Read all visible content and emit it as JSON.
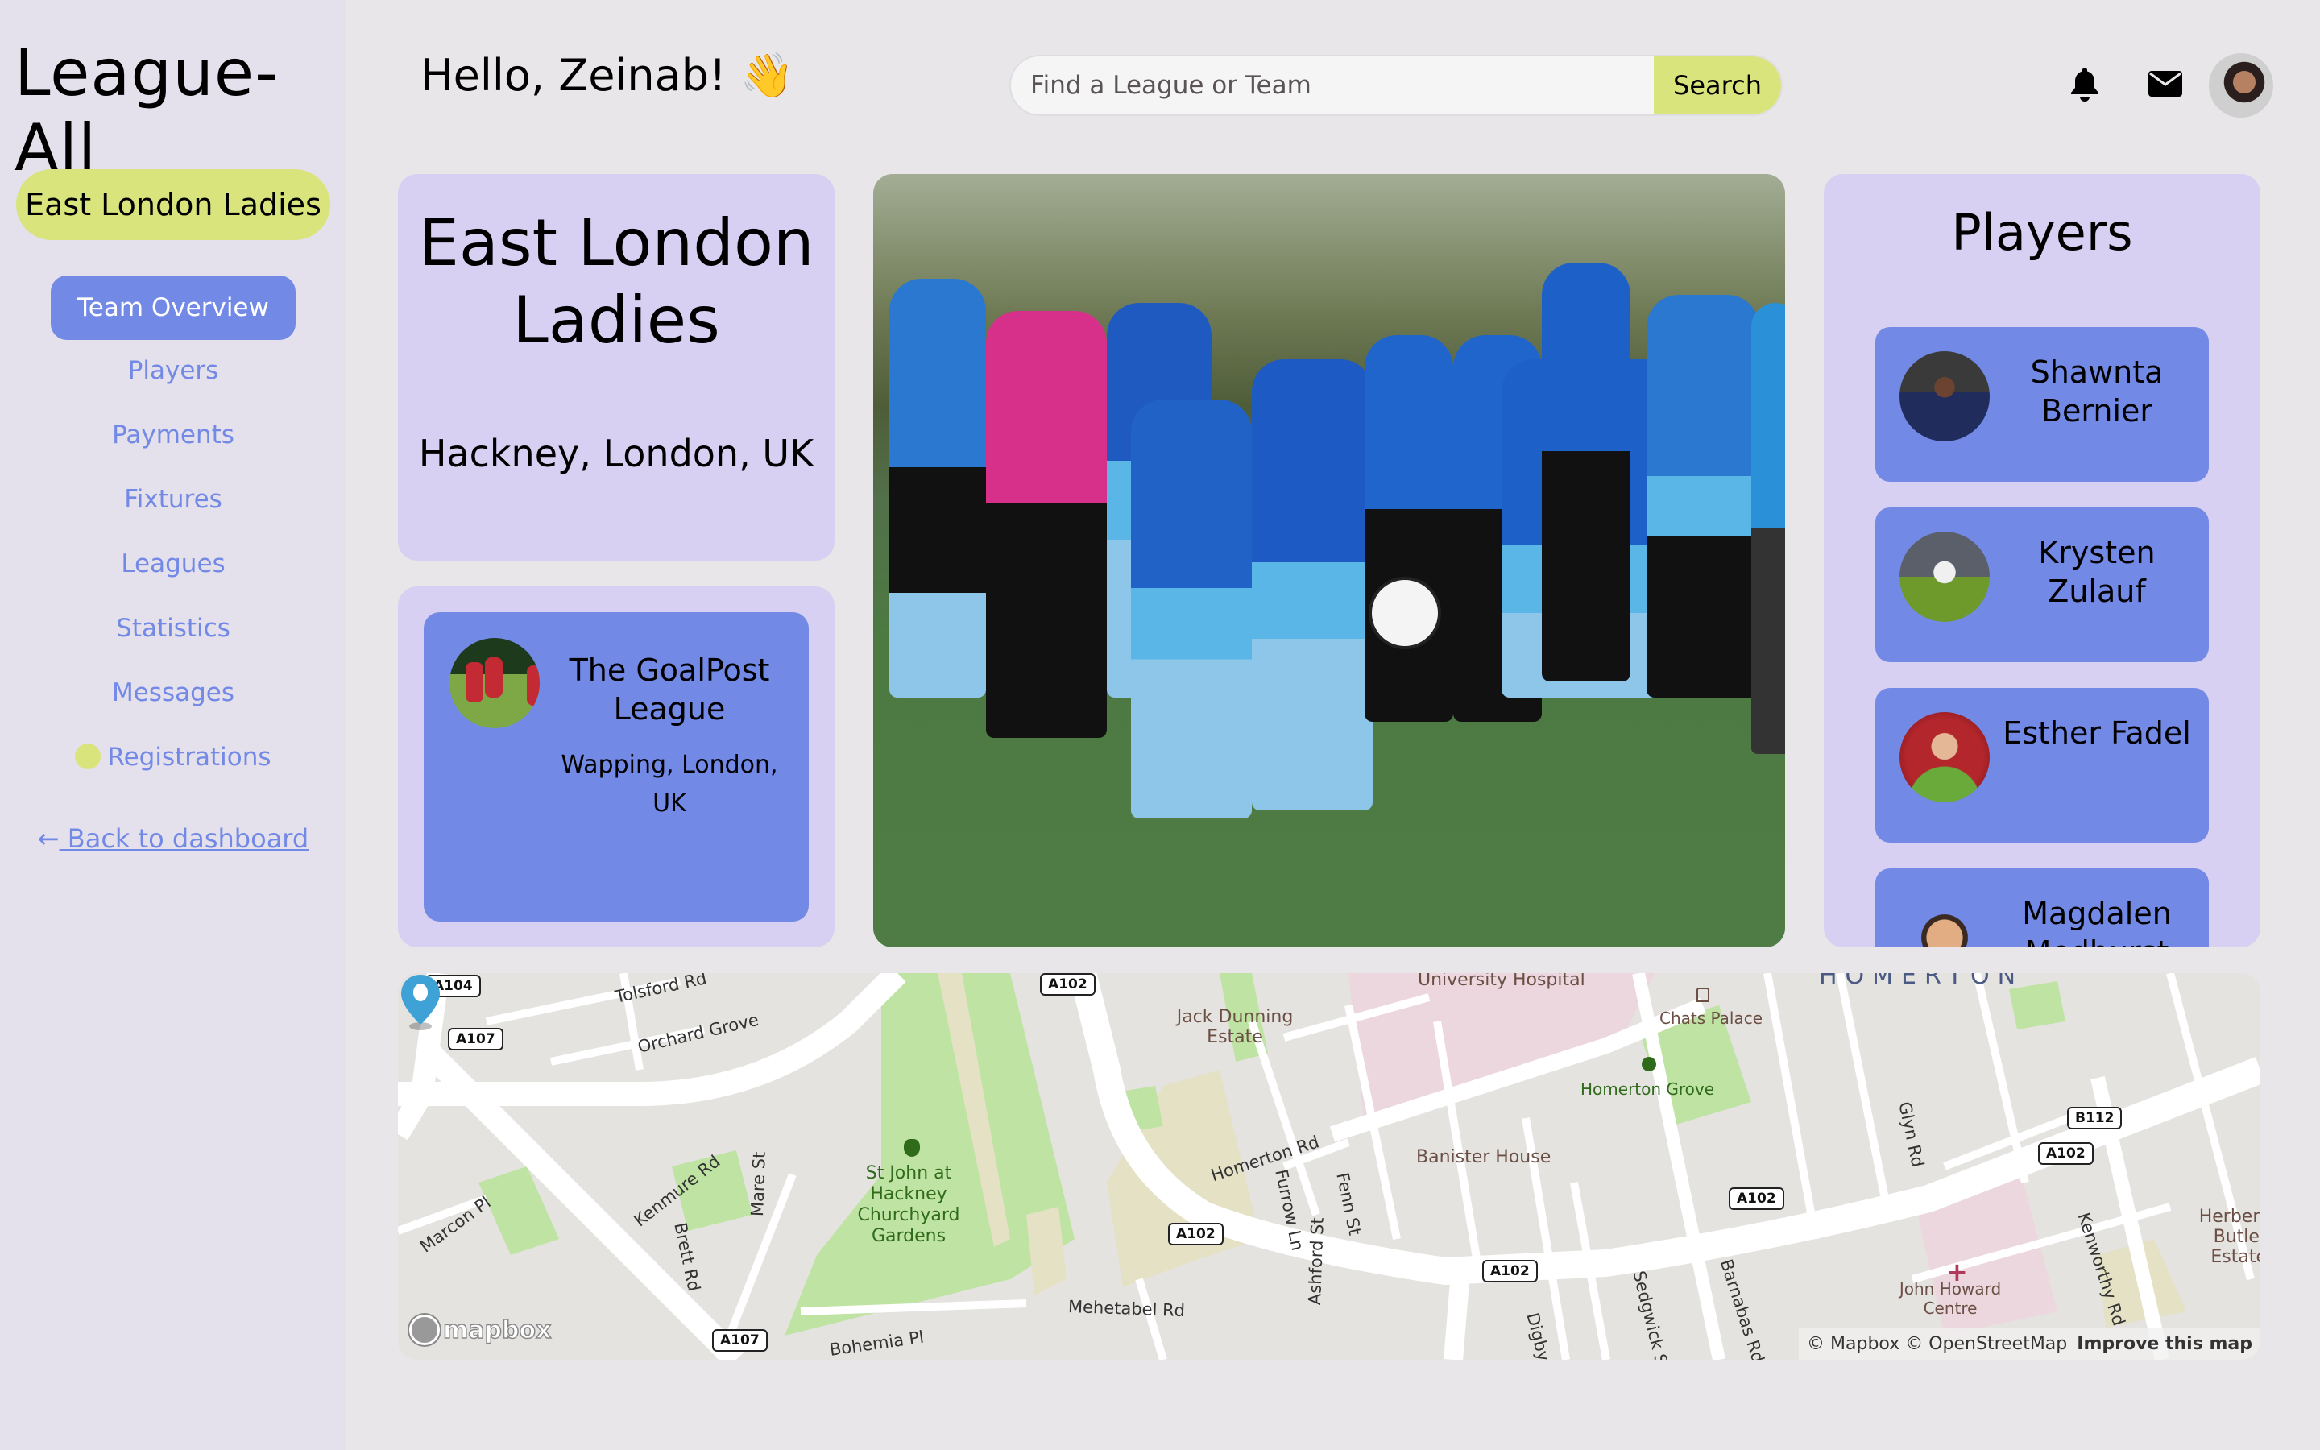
{
  "app": {
    "title": "League-All",
    "team_pill": "East London Ladies"
  },
  "sidebar": {
    "active": "Team Overview",
    "items": [
      {
        "label": "Players"
      },
      {
        "label": "Payments"
      },
      {
        "label": "Fixtures"
      },
      {
        "label": "Leagues"
      },
      {
        "label": "Statistics"
      },
      {
        "label": "Messages"
      },
      {
        "label": "Registrations",
        "status_dot": true
      }
    ],
    "back_arrow": "←",
    "back_label": " Back to dashboard"
  },
  "header": {
    "greeting": "Hello, Zeinab!",
    "greeting_emoji": "👋",
    "search_placeholder": "Find a League or Team",
    "search_value": "",
    "search_button": "Search",
    "icons": [
      "bell-icon",
      "mail-icon",
      "user-avatar"
    ]
  },
  "team": {
    "name": "East London Ladies",
    "location": "Hackney, London, UK"
  },
  "league": {
    "name": "The GoalPost League",
    "location": "Wapping, London, UK"
  },
  "players": {
    "title": "Players",
    "list": [
      {
        "name": "Shawnta Bernier"
      },
      {
        "name": "Krysten Zulauf"
      },
      {
        "name": "Esther Fadel"
      },
      {
        "name": "Magdalen Medhurst"
      }
    ]
  },
  "map": {
    "road_shields": [
      "A104",
      "A107",
      "A107",
      "A102",
      "A102",
      "A102",
      "A102",
      "A102",
      "B112"
    ],
    "streets": [
      "Tolsford Rd",
      "Orchard Grove",
      "Kenmure Rd",
      "Brett Rd",
      "Mare St",
      "Marcon Pl",
      "Homerton Rd",
      "Furrow Ln",
      "Fenn St",
      "Mehetabel Rd",
      "Digby Rd",
      "Sedgwick St",
      "Barnabas Rd",
      "Glyn Rd",
      "Kenworthy Rd",
      "Bohemia Pl",
      "Ashford St"
    ],
    "places": {
      "hospital": "University Hospital",
      "estate1": "Jack Dunning Estate",
      "banister": "Banister House",
      "chats": "Chats Palace",
      "homerton_grove": "Homerton Grove",
      "st_john": "St John at Hackney Churchyard Gardens",
      "district": "HOMERTON",
      "john_howard": "John Howard Centre",
      "herbert": "Herbert Butler Estate"
    },
    "logo": "mapbox",
    "attribution": "© Mapbox © OpenStreetMap",
    "improve": "Improve this map"
  },
  "colors": {
    "accent_blue": "#7289e6",
    "lime": "#d9e47d",
    "card_lavender": "#d8d0f2",
    "sidebar_bg": "#e4e0ec",
    "page_bg": "#e8e6e8"
  }
}
